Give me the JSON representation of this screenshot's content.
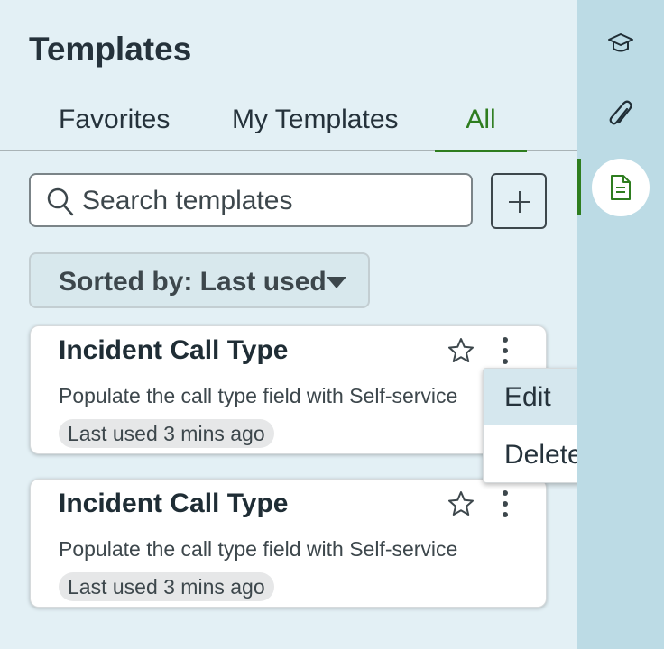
{
  "panel": {
    "title": "Templates",
    "tabs": [
      {
        "label": "Favorites",
        "active": false
      },
      {
        "label": "My Templates",
        "active": false
      },
      {
        "label": "All",
        "active": true
      }
    ],
    "search": {
      "placeholder": "Search templates",
      "value": "",
      "icon": "search-icon"
    },
    "add_button": {
      "icon": "plus-icon"
    },
    "sort": {
      "label": "Sorted by: Last used",
      "icon": "caret-down-icon"
    },
    "cards": [
      {
        "title": "Incident Call Type",
        "description": "Populate the call type field with Self-service",
        "last_used": "Last used 3 mins ago"
      },
      {
        "title": "Incident Call Type",
        "description": "Populate the call type field with Self-service",
        "last_used": "Last used 3 mins ago"
      }
    ],
    "menu": {
      "items": [
        "Edit",
        "Delete"
      ]
    }
  },
  "rail": {
    "items": [
      {
        "icon": "graduation-cap-icon",
        "active": false
      },
      {
        "icon": "paperclip-icon",
        "active": false
      },
      {
        "icon": "document-icon",
        "active": true
      }
    ]
  },
  "colors": {
    "accent": "#2e7d1f",
    "panel_bg": "#e3f0f5",
    "rail_bg": "#bcdbe5",
    "text": "#25323b"
  }
}
